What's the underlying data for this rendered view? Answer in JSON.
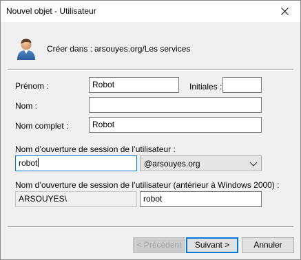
{
  "window": {
    "title": "Nouvel objet - Utilisateur"
  },
  "header": {
    "create_in_label": "Créer dans :",
    "create_in_value": "arsouyes.org/Les services"
  },
  "form": {
    "first_name_label": "Prénom :",
    "first_name_value": "Robot",
    "initials_label": "Initiales :",
    "initials_value": "",
    "last_name_label": "Nom :",
    "last_name_value": "",
    "full_name_label": "Nom complet :",
    "full_name_value": "Robot",
    "logon_label": "Nom d’ouverture de session de l’utilisateur :",
    "logon_value": "robot",
    "domain_selected": "@arsouyes.org",
    "pre2000_label": "Nom d’ouverture de session de l’utilisateur (antérieur à Windows 2000) :",
    "pre2000_domain": "ARSOUYES\\",
    "pre2000_value": "robot"
  },
  "buttons": {
    "previous": "< Précédent",
    "next": "Suivant >",
    "cancel": "Annuler"
  },
  "icons": {
    "close": "close-icon",
    "user": "user-icon",
    "dropdown": "chevron-down-icon"
  },
  "colors": {
    "focus_accent": "#0078d7",
    "dialog_bg": "#f0f0f0"
  }
}
